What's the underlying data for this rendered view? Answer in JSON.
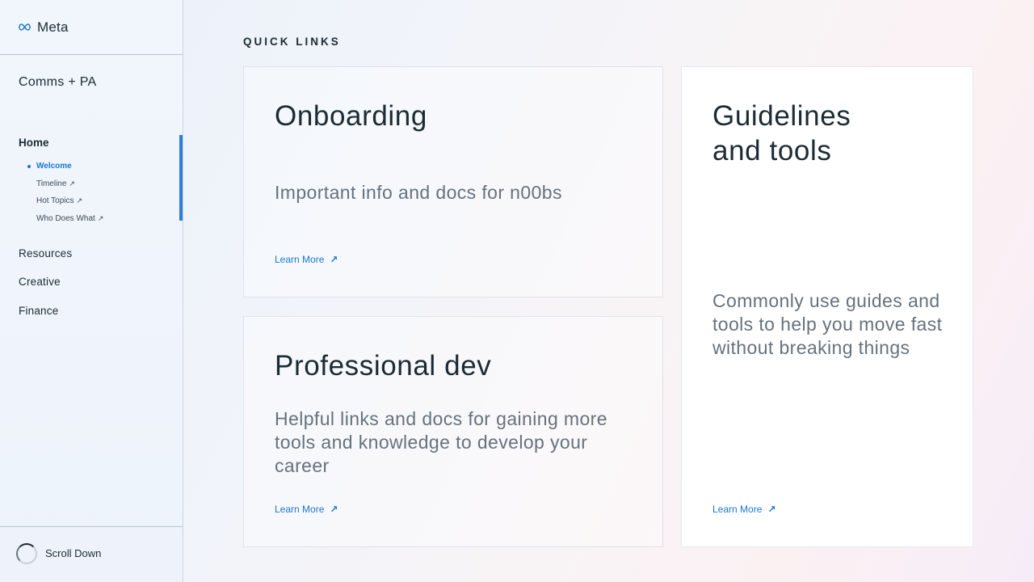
{
  "sidebar": {
    "logo_text": "Meta",
    "section_title": "Comms + PA",
    "home_label": "Home",
    "subnav": [
      {
        "label": "Welcome",
        "external": false,
        "active": true
      },
      {
        "label": "Timeline",
        "external": true,
        "active": false
      },
      {
        "label": "Hot Topics",
        "external": true,
        "active": false
      },
      {
        "label": "Who Does What",
        "external": true,
        "active": false
      }
    ],
    "main_nav": [
      "Resources",
      "Creative",
      "Finance"
    ],
    "footer_label": "Scroll Down"
  },
  "main": {
    "heading": "QUICK LINKS",
    "cards": [
      {
        "title": "Onboarding",
        "description": "Important info and docs for n00bs",
        "link_label": "Learn More"
      },
      {
        "title": "Professional dev",
        "description": "Helpful links and docs for gaining more tools and knowledge to develop your career",
        "link_label": "Learn More"
      },
      {
        "title": "Guidelines and tools",
        "description": "Commonly use guides and tools to help you move fast without breaking things",
        "link_label": "Learn More"
      }
    ]
  },
  "colors": {
    "accent": "#1877d4",
    "active_bar": "#2d7ed8",
    "text_primary": "#1c2b33",
    "text_secondary": "#66727d"
  },
  "icons": {
    "logo": "meta-infinity-icon",
    "external_link": "arrow-up-right-icon",
    "scroll": "spinner-icon"
  }
}
